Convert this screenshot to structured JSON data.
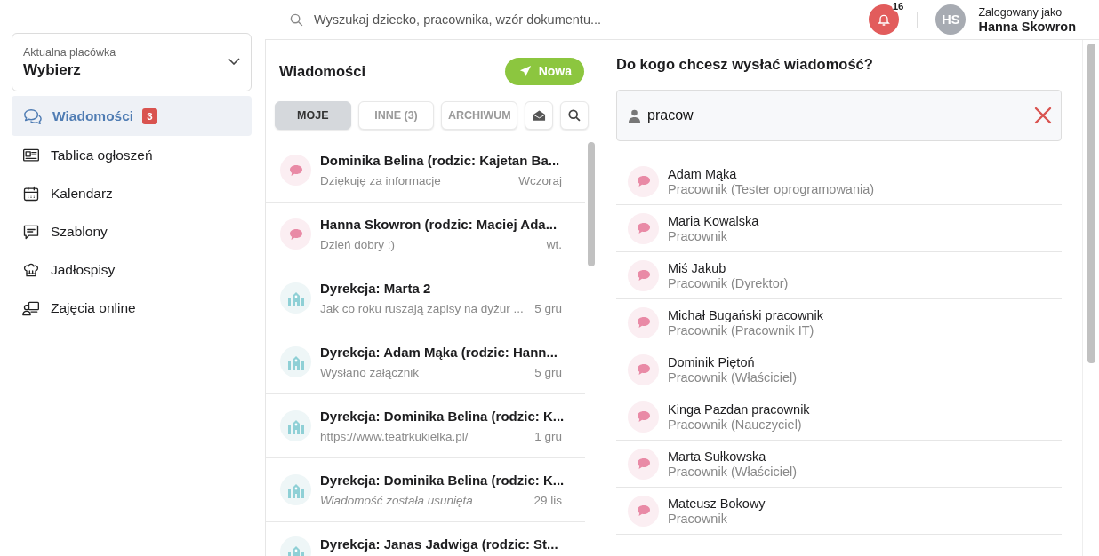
{
  "topbar": {
    "search": {
      "placeholder": "Wyszukaj dziecko, pracownika, wzór dokumentu..."
    },
    "notifications": {
      "count": "16"
    },
    "user": {
      "initials": "HS",
      "label": "Zalogowany jako",
      "name": "Hanna Skowron"
    }
  },
  "sidebar": {
    "facility": {
      "label": "Aktualna placówka",
      "value": "Wybierz"
    },
    "items": [
      {
        "label": "Wiadomości",
        "kind": "chat",
        "selected": true,
        "badge": "3"
      },
      {
        "label": "Tablica ogłoszeń",
        "kind": "board",
        "selected": false
      },
      {
        "label": "Kalendarz",
        "kind": "calendar",
        "selected": false
      },
      {
        "label": "Szablony",
        "kind": "template",
        "selected": false
      },
      {
        "label": "Jadłospisy",
        "kind": "chef",
        "selected": false
      },
      {
        "label": "Zajęcia online",
        "kind": "online",
        "selected": false
      }
    ]
  },
  "messages": {
    "title": "Wiadomości",
    "new_button": "Nowa",
    "tabs": [
      {
        "label": "MOJE",
        "selected": true
      },
      {
        "label": "INNE (3)",
        "selected": false
      },
      {
        "label": "ARCHIWUM",
        "selected": false
      }
    ],
    "conversations": [
      {
        "kind": "parent",
        "title": "Dominika Belina (rodzic: Kajetan Ba...",
        "preview": "Dziękuję za informacje",
        "date": "Wczoraj",
        "deleted": false
      },
      {
        "kind": "parent",
        "title": "Hanna Skowron (rodzic: Maciej Ada...",
        "preview": "Dzień dobry :)",
        "date": "wt.",
        "deleted": false
      },
      {
        "kind": "school",
        "title": "Dyrekcja: Marta 2",
        "preview": "Jak co roku ruszają zapisy na dyżur ...",
        "date": "5 gru",
        "deleted": false
      },
      {
        "kind": "school",
        "title": "Dyrekcja: Adam Mąka (rodzic: Hann...",
        "preview": "Wysłano załącznik",
        "date": "5 gru",
        "deleted": false
      },
      {
        "kind": "school",
        "title": "Dyrekcja: Dominika Belina (rodzic: K...",
        "preview": "https://www.teatrkukielka.pl/",
        "date": "1 gru",
        "deleted": false
      },
      {
        "kind": "school",
        "title": "Dyrekcja: Dominika Belina (rodzic: K...",
        "preview": "Wiadomość została usunięta",
        "date": "29 lis",
        "deleted": true
      },
      {
        "kind": "school",
        "title": "Dyrekcja: Janas Jadwiga (rodzic: St..."
      }
    ]
  },
  "recipients": {
    "title": "Do kogo chcesz wysłać wiadomość?",
    "search": {
      "value": "pracow"
    },
    "items": [
      {
        "name": "Adam Mąka",
        "role": "Pracownik (Tester oprogramowania)"
      },
      {
        "name": "Maria Kowalska",
        "role": "Pracownik"
      },
      {
        "name": "Miś Jakub",
        "role": "Pracownik (Dyrektor)"
      },
      {
        "name": "Michał Bugański pracownik",
        "role": "Pracownik (Pracownik IT)"
      },
      {
        "name": "Dominik Piętoń",
        "role": "Pracownik (Właściciel)"
      },
      {
        "name": "Kinga Pazdan pracownik",
        "role": "Pracownik (Nauczyciel)"
      },
      {
        "name": "Marta Sułkowska",
        "role": "Pracownik (Właściciel)"
      },
      {
        "name": "Mateusz Bokowy",
        "role": "Pracownik"
      }
    ]
  }
}
